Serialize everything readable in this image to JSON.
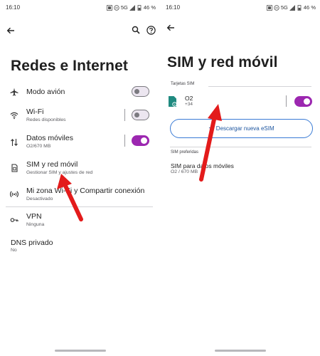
{
  "left": {
    "status": {
      "time": "16:10",
      "network": "5G",
      "battery": "46 %"
    },
    "title": "Redes e Internet",
    "items": [
      {
        "title": "Modo avión",
        "sub": ""
      },
      {
        "title": "Wi-Fi",
        "sub": "Redes disponibles"
      },
      {
        "title": "Datos móviles",
        "sub": "O2/670 MB"
      },
      {
        "title": "SIM y red móvil",
        "sub": "Gestionar SIM y ajustes de red"
      },
      {
        "title": "Mi zona Wi-Fi y Compartir conexión",
        "sub": "Desactivado"
      },
      {
        "title": "VPN",
        "sub": "Ninguna"
      },
      {
        "title": "DNS privado",
        "sub": "No"
      }
    ],
    "toggles": {
      "airplane": false,
      "wifi": false,
      "mobile_data": true
    }
  },
  "right": {
    "status": {
      "time": "16:10",
      "network": "5G",
      "battery": "46 %"
    },
    "title": "SIM y red móvil",
    "sim_section": "Tarjetas SIM",
    "sim": {
      "name": "O2",
      "number": "+34",
      "enabled": true
    },
    "esim_button": "Descargar nueva eSIM",
    "preferred_section": "SIM preferidas",
    "preferred": {
      "title": "SIM para datos móviles",
      "sub": "O2 / 670 MB"
    }
  },
  "colors": {
    "accent": "#9c27b0",
    "arrow": "#e31b1b",
    "link": "#1e56a0",
    "sim_icon": "#1f8a80"
  }
}
